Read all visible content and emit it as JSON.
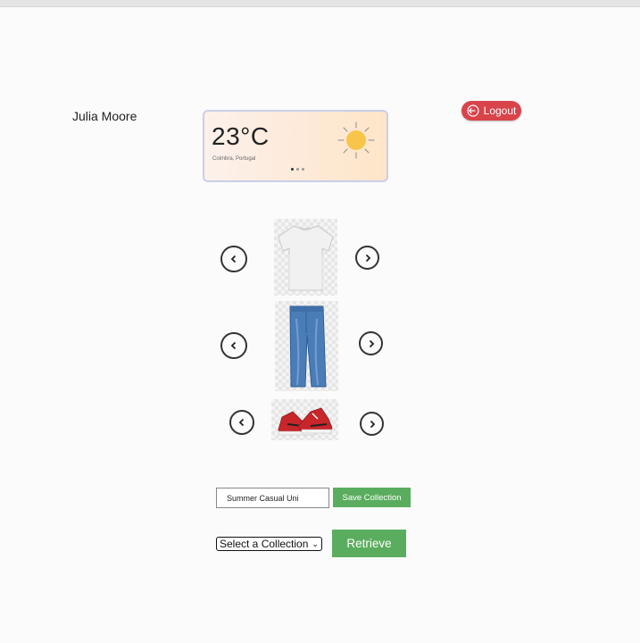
{
  "header": {
    "user_name": "Julia Moore",
    "logout_label": "Logout"
  },
  "weather": {
    "temperature": "23°C",
    "location": "Coimbra, Portugal",
    "icon": "sun-icon",
    "slide_count": 3,
    "active_slide": 1
  },
  "outfit": {
    "top": {
      "item": "white t-shirt",
      "icon": "tshirt-image"
    },
    "bottom": {
      "item": "blue jeans",
      "icon": "jeans-image"
    },
    "shoes": {
      "item": "red sneakers",
      "icon": "sneakers-image"
    }
  },
  "collection": {
    "name_value": "Summer Casual Uni",
    "save_label": "Save Collection",
    "select_value": "Select a Collection",
    "retrieve_label": "Retrieve"
  },
  "colors": {
    "logout": "#d9434a",
    "primary_green": "#5aad5e",
    "sun": "#f7c54a"
  }
}
